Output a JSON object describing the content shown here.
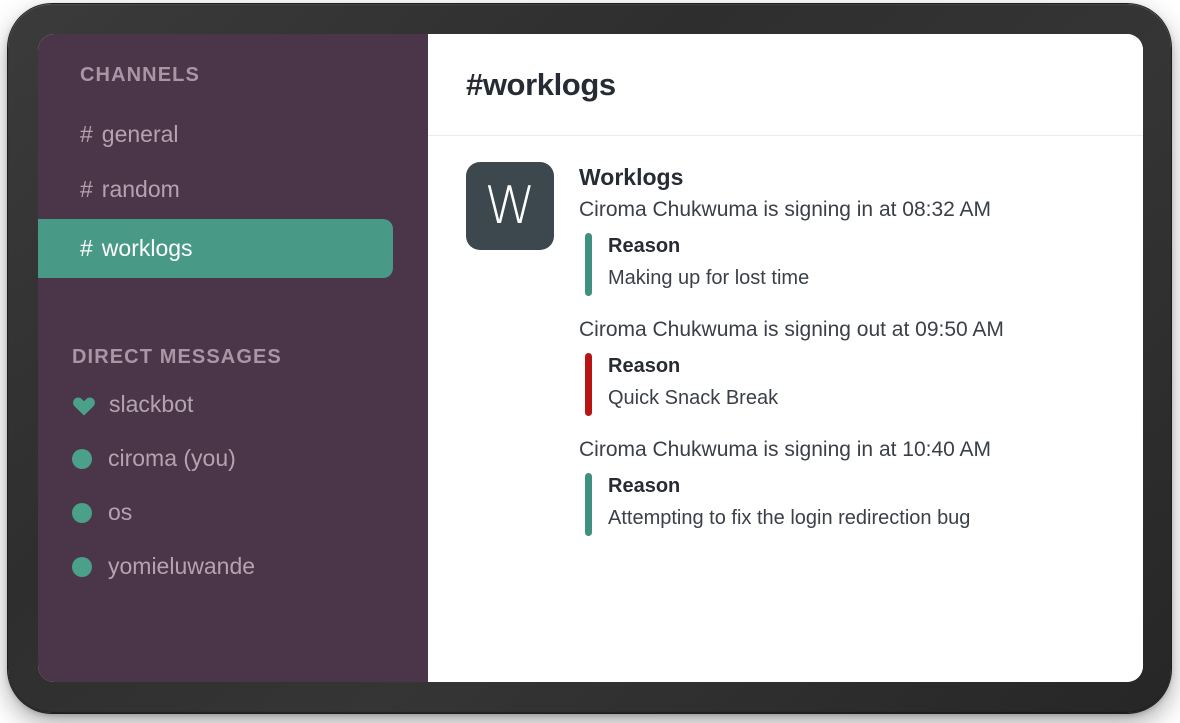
{
  "sidebar": {
    "channels_title": "CHANNELS",
    "channels": [
      {
        "hash": "#",
        "label": "general",
        "active": false
      },
      {
        "hash": "#",
        "label": "random",
        "active": false
      },
      {
        "hash": "#",
        "label": "worklogs",
        "active": true
      }
    ],
    "dm_title": "DIRECT MESSAGES",
    "dms": [
      {
        "icon": "heart-icon",
        "label": "slackbot"
      },
      {
        "icon": "presence-dot-icon",
        "label": "ciroma (you)"
      },
      {
        "icon": "presence-dot-icon",
        "label": "os"
      },
      {
        "icon": "presence-dot-icon",
        "label": "yomieluwande"
      }
    ]
  },
  "main": {
    "channel_title": "#worklogs",
    "bot_avatar_letter": "W",
    "bot_name": "Worklogs",
    "entries": [
      {
        "text": "Ciroma Chukwuma is signing in at 08:32 AM",
        "reason_title": "Reason",
        "reason_text": "Making up for lost time",
        "bar_color": "#3f9080"
      },
      {
        "text": "Ciroma Chukwuma is signing out at 09:50 AM",
        "reason_title": "Reason",
        "reason_text": "Quick Snack Break",
        "bar_color": "#b81414"
      },
      {
        "text": "Ciroma Chukwuma is signing in at 10:40 AM",
        "reason_title": "Reason",
        "reason_text": "Attempting to fix the login redirection bug",
        "bar_color": "#3f9080"
      }
    ]
  },
  "colors": {
    "sidebar_bg": "#4b3649",
    "active_channel": "#489a86",
    "presence_green": "#4aa088",
    "avatar_bg": "#3c474e",
    "reason_green": "#3f9080",
    "reason_red": "#b81414"
  }
}
